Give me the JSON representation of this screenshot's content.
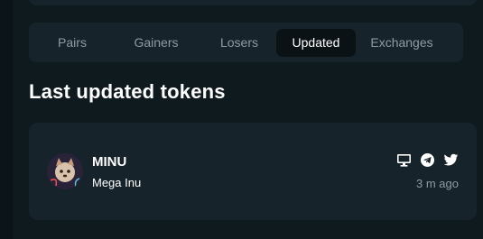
{
  "tabs": [
    {
      "label": "Pairs"
    },
    {
      "label": "Gainers"
    },
    {
      "label": "Losers"
    },
    {
      "label": "Updated"
    },
    {
      "label": "Exchanges"
    }
  ],
  "active_tab": "Updated",
  "section": {
    "title": "Last updated tokens"
  },
  "token": {
    "symbol": "MINU",
    "name": "Mega Inu",
    "updated": "3 m ago",
    "links": [
      "monitor-icon",
      "telegram-icon",
      "twitter-icon"
    ]
  },
  "colors": {
    "background": "#0f1a1f",
    "card": "#16232a",
    "active_tab": "#0b1216",
    "muted_text": "#8d9ba3",
    "text": "#ffffff"
  }
}
